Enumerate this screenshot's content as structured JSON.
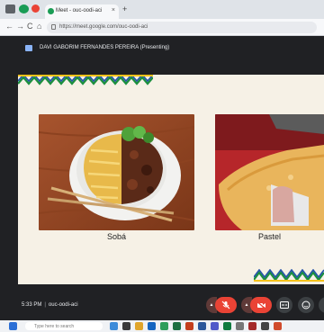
{
  "browser": {
    "tab_title": "Meet - ouc-oodi-aci",
    "tab_close": "×",
    "new_tab": "+",
    "url": "https://meet.google.com/ouc-oodi-aci",
    "nav": {
      "back": "←",
      "forward": "→",
      "reload": "C",
      "home": "⌂"
    }
  },
  "meet": {
    "presenter_label": "DAVI GABORIM FERNANDES PEREIRA (Presenting)",
    "time": "5:33 PM",
    "separator": "|",
    "meeting_code": "ouc-oodi-aci"
  },
  "slide": {
    "items": [
      {
        "caption": "Sobá"
      },
      {
        "caption": "Pastel"
      }
    ],
    "zigzag_colors": [
      "#1b8f3e",
      "#f4c21b",
      "#2554a8",
      "#ffffff"
    ]
  },
  "taskbar": {
    "search_placeholder": "Type here to search"
  },
  "colors": {
    "accent_red": "#ea4335",
    "stage": "#202124",
    "slide_bg": "#f6f1e6"
  }
}
